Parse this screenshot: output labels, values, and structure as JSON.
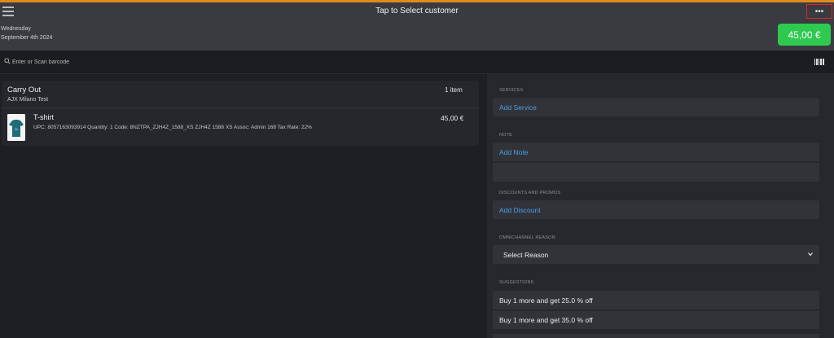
{
  "header": {
    "customer_prompt": "Tap to Select customer",
    "weekday": "Wednesday",
    "date": "September 4th 2024",
    "more_label": "•••",
    "total": "45,00 €"
  },
  "search": {
    "placeholder": "Enter or Scan barcode"
  },
  "order": {
    "type": "Carry Out",
    "store": "AJX Milano Test",
    "item_count": "1 item",
    "items": [
      {
        "name": "T-shirt",
        "details": "UPC: 8057163093914  Quantity: 1  Code: 8NZTPA_ZJH4Z_1588_XS  ZJH4Z  1588  XS  Assoc: Admin 168  Tax Rate: 22%",
        "price": "45,00 €"
      }
    ]
  },
  "panel": {
    "services_label": "SERVICES",
    "add_service": "Add Service",
    "note_label": "NOTE",
    "add_note": "Add Note",
    "discounts_label": "DISCOUNTS AND PROMOS",
    "add_discount": "Add Discount",
    "omnichannel_label": "OMNICHANNEL REASON",
    "select_reason": "Select Reason",
    "suggestions_label": "SUGGESTIONS",
    "suggestions": [
      "Buy 1 more and get 25.0 % off",
      "Buy 1 more and get 35.0 % off"
    ]
  },
  "colors": {
    "accent_bar": "#e08a1e",
    "total_button": "#2fc94f",
    "link": "#4d9ee8",
    "highlight_border": "#e0262b"
  },
  "icons": [
    "hamburger-menu-icon",
    "more-icon",
    "search-icon",
    "barcode-icon",
    "chevron-down-icon",
    "tshirt-icon"
  ]
}
